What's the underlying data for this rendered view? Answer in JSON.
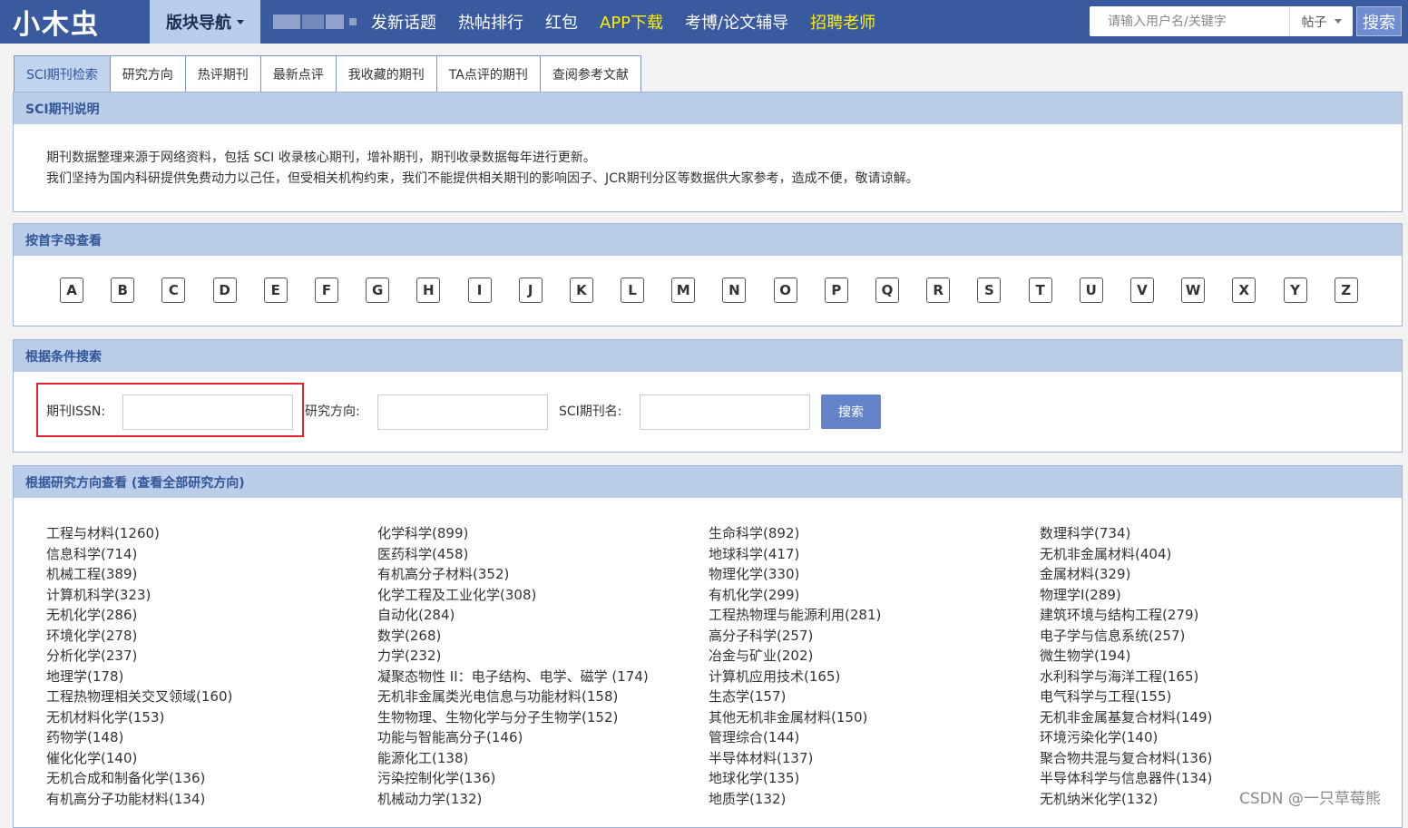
{
  "header": {
    "logo": "小木虫",
    "block_nav": "版块导航",
    "links": [
      {
        "label": "发新话题",
        "highlight": false
      },
      {
        "label": "热帖排行",
        "highlight": false
      },
      {
        "label": "红包",
        "highlight": false
      },
      {
        "label": "APP下载",
        "highlight": true
      },
      {
        "label": "考博/论文辅导",
        "highlight": false
      },
      {
        "label": "招聘老师",
        "highlight": true
      }
    ],
    "search_placeholder": "请输入用户名/关键字",
    "search_type": "帖子",
    "search_button": "搜索"
  },
  "tabs": [
    "SCI期刊检索",
    "研究方向",
    "热评期刊",
    "最新点评",
    "我收藏的期刊",
    "TA点评的期刊",
    "查阅参考文献"
  ],
  "about": {
    "title": "SCI期刊说明",
    "line1": "期刊数据整理来源于网络资料，包括 SCI 收录核心期刊，增补期刊，期刊收录数据每年进行更新。",
    "line2": "我们坚持为国内科研提供免费动力以己任，但受相关机构约束，我们不能提供相关期刊的影响因子、JCR期刊分区等数据供大家参考，造成不便，敬请谅解。"
  },
  "letters": {
    "title": "按首字母查看",
    "items": [
      "A",
      "B",
      "C",
      "D",
      "E",
      "F",
      "G",
      "H",
      "I",
      "J",
      "K",
      "L",
      "M",
      "N",
      "O",
      "P",
      "Q",
      "R",
      "S",
      "T",
      "U",
      "V",
      "W",
      "X",
      "Y",
      "Z"
    ]
  },
  "search": {
    "title": "根据条件搜索",
    "issn_label": "期刊ISSN:",
    "field_label": "研究方向:",
    "name_label": "SCI期刊名:",
    "button": "搜索"
  },
  "fields": {
    "title": "根据研究方向查看 (查看全部研究方向)",
    "items": [
      "工程与材料(1260)",
      "化学科学(899)",
      "生命科学(892)",
      "数理科学(734)",
      "信息科学(714)",
      "医药科学(458)",
      "地球科学(417)",
      "无机非金属材料(404)",
      "机械工程(389)",
      "有机高分子材料(352)",
      "物理化学(330)",
      "金属材料(329)",
      "计算机科学(323)",
      "化学工程及工业化学(308)",
      "有机化学(299)",
      "物理学I(289)",
      "无机化学(286)",
      "自动化(284)",
      "工程热物理与能源利用(281)",
      "建筑环境与结构工程(279)",
      "环境化学(278)",
      "数学(268)",
      "高分子科学(257)",
      "电子学与信息系统(257)",
      "分析化学(237)",
      "力学(232)",
      "冶金与矿业(202)",
      "微生物学(194)",
      "地理学(178)",
      "凝聚态物性 II：电子结构、电学、磁学 (174)",
      "计算机应用技术(165)",
      "水利科学与海洋工程(165)",
      "工程热物理相关交叉领域(160)",
      "无机非金属类光电信息与功能材料(158)",
      "生态学(157)",
      "电气科学与工程(155)",
      "无机材料化学(153)",
      "生物物理、生物化学与分子生物学(152)",
      "其他无机非金属材料(150)",
      "无机非金属基复合材料(149)",
      "药物学(148)",
      "功能与智能高分子(146)",
      "管理综合(144)",
      "环境污染化学(140)",
      "催化化学(140)",
      "能源化工(138)",
      "半导体材料(137)",
      "聚合物共混与复合材料(136)",
      "无机合成和制备化学(136)",
      "污染控制化学(136)",
      "地球化学(135)",
      "半导体科学与信息器件(134)",
      "有机高分子功能材料(134)",
      "机械动力学(132)",
      "地质学(132)",
      "无机纳米化学(132)"
    ]
  },
  "watermark": "CSDN @一只草莓熊"
}
